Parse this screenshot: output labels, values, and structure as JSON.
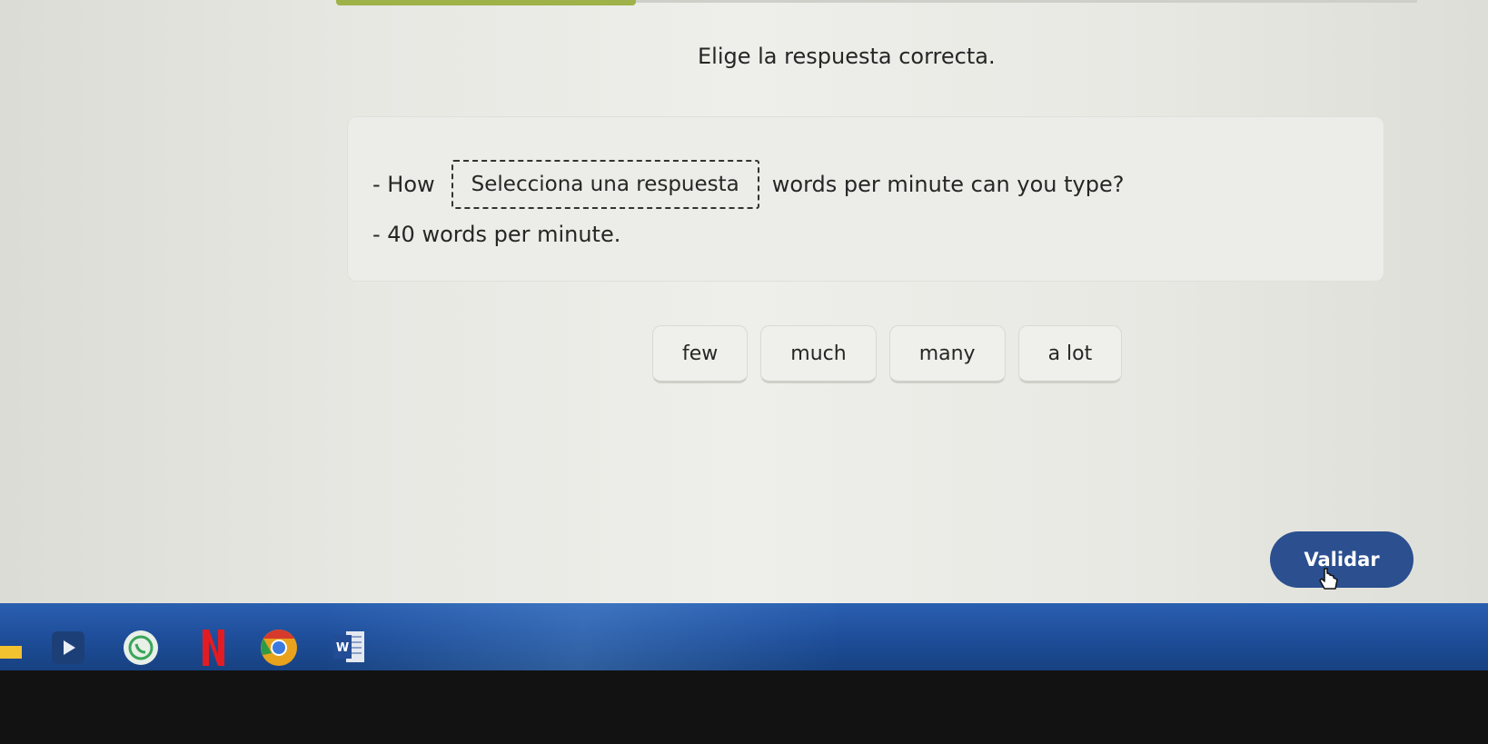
{
  "exercise": {
    "instruction": "Elige la respuesta correcta.",
    "sentence_before": "- How",
    "blank_placeholder": "Selecciona una respuesta",
    "sentence_after": "words per minute can you type?",
    "answer_line": "- 40 words per minute."
  },
  "options": [
    {
      "label": "few"
    },
    {
      "label": "much"
    },
    {
      "label": "many"
    },
    {
      "label": "a lot"
    }
  ],
  "actions": {
    "validate_label": "Validar"
  },
  "colors": {
    "validate_button": "#2b4f8f",
    "progress_bar": "#9fb24a",
    "taskbar": "#1f4f9c"
  },
  "taskbar": {
    "apps": [
      {
        "icon": "play-store-icon"
      },
      {
        "icon": "whatsapp-icon"
      },
      {
        "icon": "netflix-icon"
      },
      {
        "icon": "chrome-icon"
      },
      {
        "icon": "word-icon",
        "label": "W"
      }
    ]
  }
}
